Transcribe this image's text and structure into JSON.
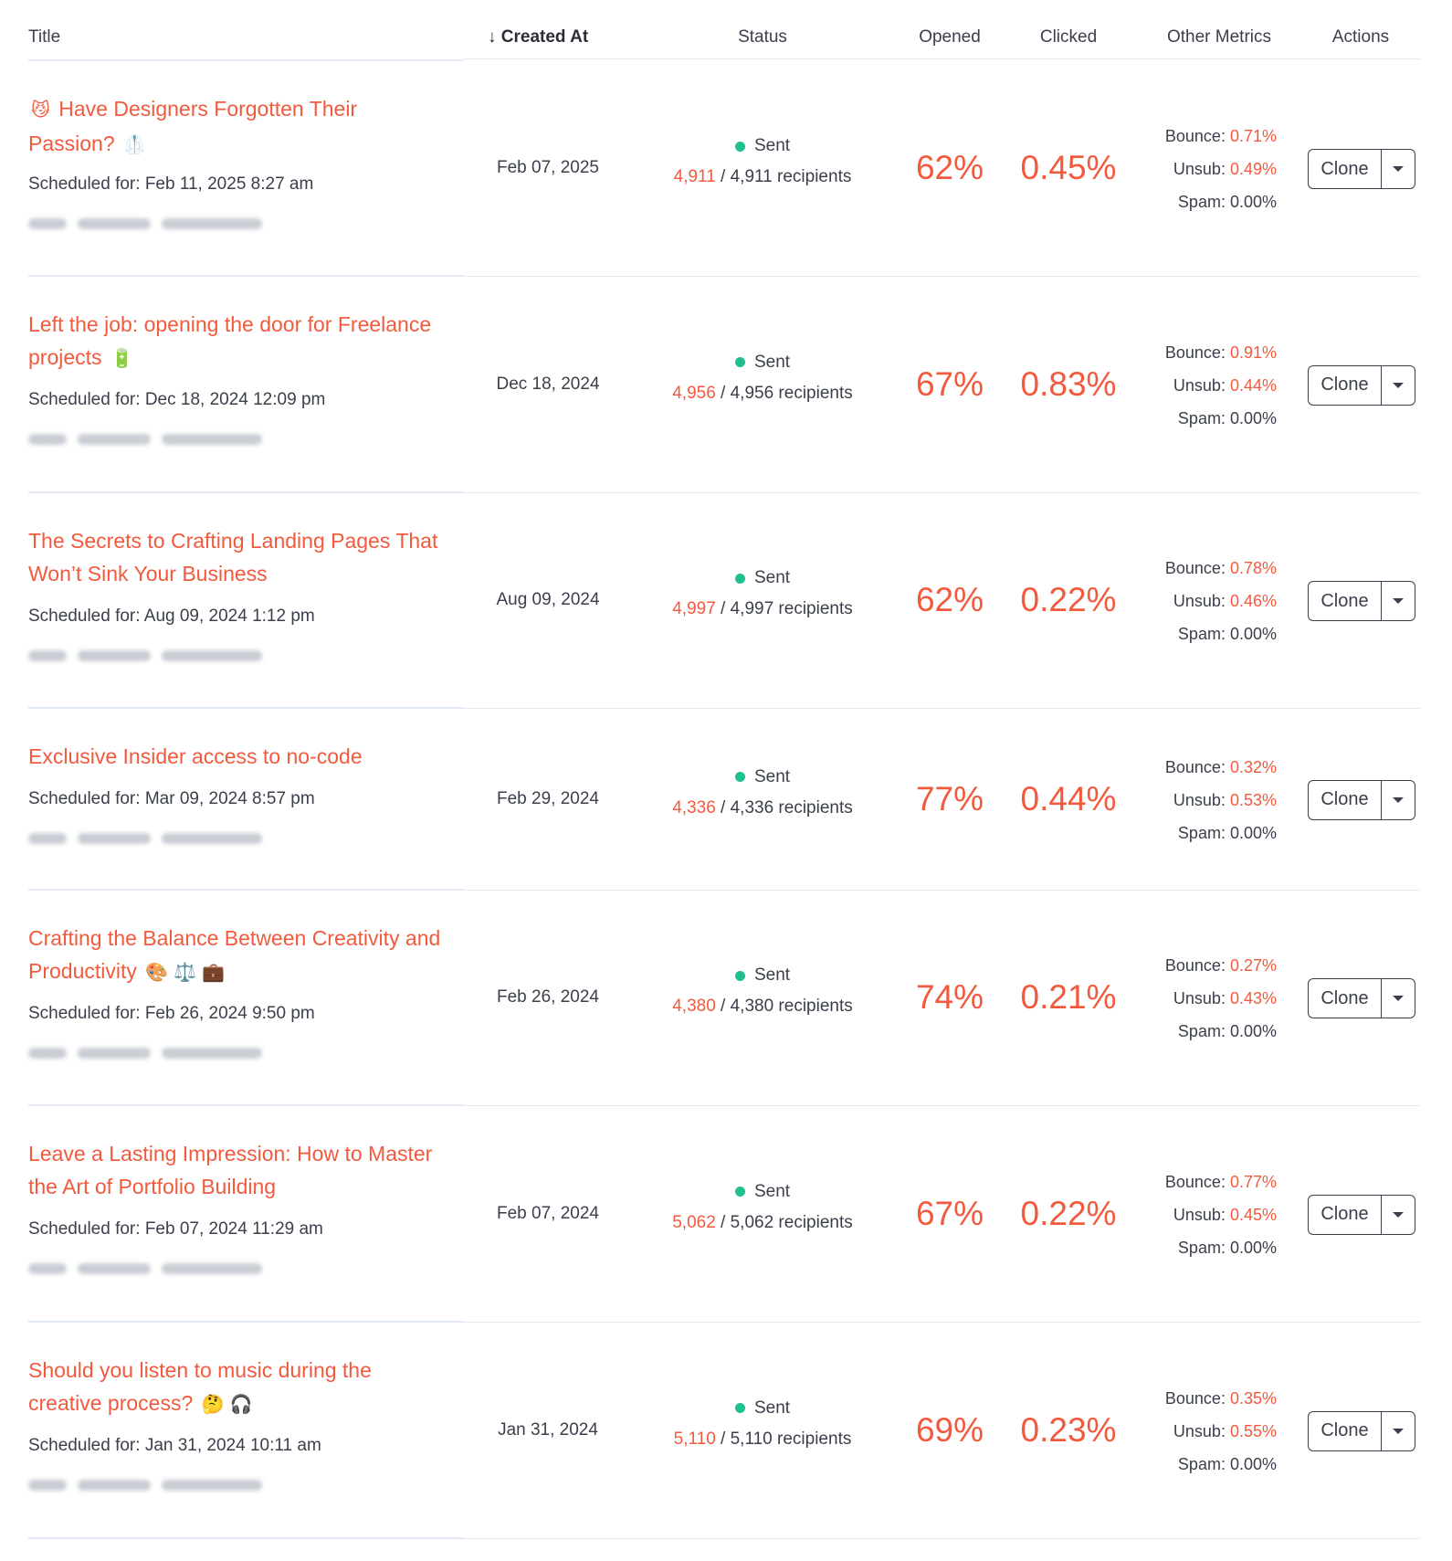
{
  "columns": {
    "title": "Title",
    "created_at": "↓ Created At",
    "status": "Status",
    "opened": "Opened",
    "clicked": "Clicked",
    "other_metrics": "Other Metrics",
    "actions": "Actions"
  },
  "colors": {
    "accent": "#f25a3e",
    "status_dot": "#1fbf8f",
    "text": "#3a3f4b"
  },
  "labels": {
    "scheduled_prefix": "Scheduled for: ",
    "recipients_suffix": " recipients",
    "bounce": "Bounce: ",
    "unsub": "Unsub: ",
    "spam": "Spam: ",
    "clone": "Clone"
  },
  "rows": [
    {
      "title": "Have Designers Forgotten Their Passion?",
      "emoji_before": "😼",
      "emoji_after": [
        "🥼"
      ],
      "scheduled": "Feb 11, 2025 8:27 am",
      "created": "Feb 07, 2025",
      "status": "Sent",
      "sent": "4,911",
      "total": "4,911",
      "opened": "62%",
      "clicked": "0.45%",
      "bounce": "0.71%",
      "unsub": "0.49%",
      "spam": "0.00%"
    },
    {
      "title": "Left the job: opening the door for Freelance projects",
      "emoji_before": "",
      "emoji_after": [
        "🔋"
      ],
      "scheduled": "Dec 18, 2024 12:09 pm",
      "created": "Dec 18, 2024",
      "status": "Sent",
      "sent": "4,956",
      "total": "4,956",
      "opened": "67%",
      "clicked": "0.83%",
      "bounce": "0.91%",
      "unsub": "0.44%",
      "spam": "0.00%"
    },
    {
      "title": "The Secrets to Crafting Landing Pages That Won’t Sink Your Business",
      "emoji_before": "",
      "emoji_after": [],
      "scheduled": "Aug 09, 2024 1:12 pm",
      "created": "Aug 09, 2024",
      "status": "Sent",
      "sent": "4,997",
      "total": "4,997",
      "opened": "62%",
      "clicked": "0.22%",
      "bounce": "0.78%",
      "unsub": "0.46%",
      "spam": "0.00%"
    },
    {
      "title": "Exclusive Insider access to no-code",
      "emoji_before": "",
      "emoji_after": [],
      "scheduled": "Mar 09, 2024 8:57 pm",
      "created": "Feb 29, 2024",
      "status": "Sent",
      "sent": "4,336",
      "total": "4,336",
      "opened": "77%",
      "clicked": "0.44%",
      "bounce": "0.32%",
      "unsub": "0.53%",
      "spam": "0.00%"
    },
    {
      "title": "Crafting the Balance Between Creativity and Productivity",
      "emoji_before": "",
      "emoji_after": [
        "🎨",
        "⚖️",
        "💼"
      ],
      "scheduled": "Feb 26, 2024 9:50 pm",
      "created": "Feb 26, 2024",
      "status": "Sent",
      "sent": "4,380",
      "total": "4,380",
      "opened": "74%",
      "clicked": "0.21%",
      "bounce": "0.27%",
      "unsub": "0.43%",
      "spam": "0.00%"
    },
    {
      "title": "Leave a Lasting Impression: How to Master the Art of Portfolio Building",
      "emoji_before": "",
      "emoji_after": [],
      "scheduled": "Feb 07, 2024 11:29 am",
      "created": "Feb 07, 2024",
      "status": "Sent",
      "sent": "5,062",
      "total": "5,062",
      "opened": "67%",
      "clicked": "0.22%",
      "bounce": "0.77%",
      "unsub": "0.45%",
      "spam": "0.00%"
    },
    {
      "title": "Should you listen to music during the creative process?",
      "emoji_before": "",
      "emoji_after": [
        "🤔",
        "🎧"
      ],
      "scheduled": "Jan 31, 2024 10:11 am",
      "created": "Jan 31, 2024",
      "status": "Sent",
      "sent": "5,110",
      "total": "5,110",
      "opened": "69%",
      "clicked": "0.23%",
      "bounce": "0.35%",
      "unsub": "0.55%",
      "spam": "0.00%"
    }
  ]
}
